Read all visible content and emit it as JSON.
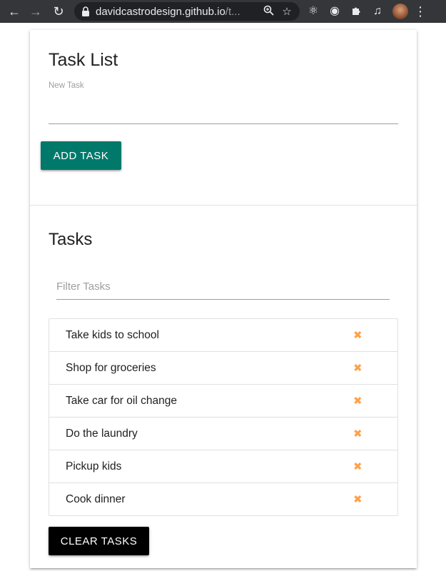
{
  "browser": {
    "url_host": "davidcastrodesign.github.io",
    "url_path": "/t...",
    "icons": {
      "back": "arrow-left",
      "forward": "arrow-right",
      "reload": "reload",
      "lock": "lock",
      "zoom": "magnifier",
      "bookmark": "star",
      "react_ext": "atom",
      "ext2": "circle",
      "extensions": "puzzle",
      "media": "playlist",
      "menu": "dots-vertical"
    }
  },
  "task_form": {
    "title": "Task List",
    "new_task_label": "New Task",
    "new_task_value": "",
    "add_button_label": "ADD TASK",
    "add_button_color": "#00796b"
  },
  "tasks_section": {
    "title": "Tasks",
    "filter_placeholder": "Filter Tasks",
    "filter_value": "",
    "items": [
      {
        "label": "Take kids to school"
      },
      {
        "label": "Shop for groceries"
      },
      {
        "label": "Take car for oil change"
      },
      {
        "label": "Do the laundry"
      },
      {
        "label": "Pickup kids"
      },
      {
        "label": "Cook dinner"
      }
    ],
    "delete_icon": "x-mark",
    "delete_icon_color": "#ffa04a",
    "clear_button_label": "CLEAR TASKS",
    "clear_button_color": "#000000"
  }
}
